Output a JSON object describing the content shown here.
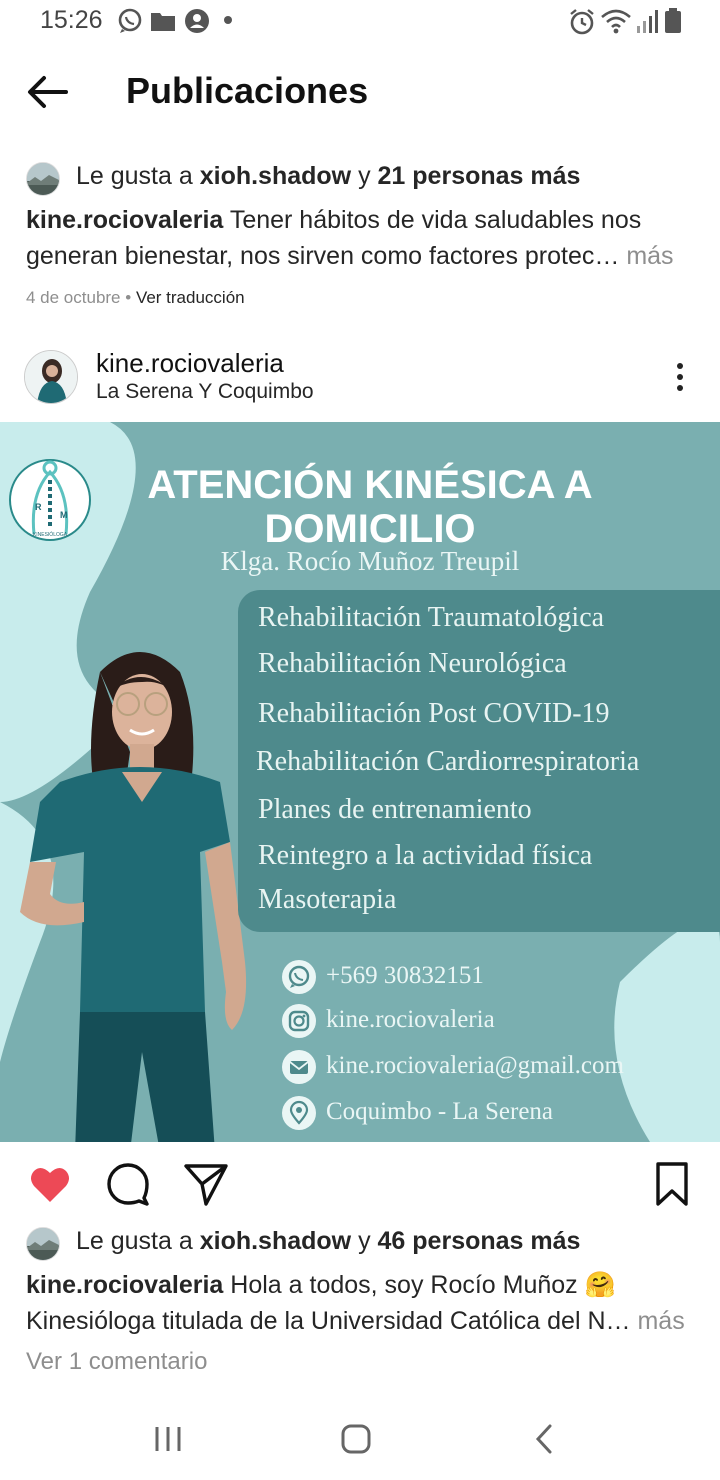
{
  "status_bar": {
    "time": "15:26",
    "left_icons": [
      "whatsapp-icon",
      "folder-icon",
      "account-icon"
    ],
    "right_icons": [
      "alarm-icon",
      "wifi-icon",
      "signal-icon",
      "battery-icon"
    ]
  },
  "header": {
    "title": "Publicaciones",
    "back_icon": "arrow-left-icon"
  },
  "previous_post": {
    "likes_prefix": "Le gusta a",
    "likes_user": "xioh.shadow",
    "likes_joiner": "y",
    "likes_count": "21 personas más",
    "caption_user": "kine.rociovaleria",
    "caption_text": "Tener hábitos de vida saludables nos generan bienestar, nos sirven como factores protec…",
    "more_label": "más",
    "date": "4 de octubre",
    "separator": "•",
    "translate_label": "Ver traducción"
  },
  "post": {
    "username": "kine.rociovaleria",
    "location": "La Serena Y Coquimbo",
    "image": {
      "logo_text": "KINESIÓLOGA",
      "logo_letters": [
        "R",
        "M"
      ],
      "title_line1": "ATENCIÓN KINÉSICA A",
      "title_line2": "DOMICILIO",
      "subtitle": "Klga. Rocío Muñoz Treupil",
      "services": [
        "Rehabilitación Traumatológica",
        "Rehabilitación Neurológica",
        "Rehabilitación Post COVID-19",
        "Rehabilitación Cardiorrespiratoria",
        "Planes de entrenamiento",
        "Reintegro a la actividad física",
        "Masoterapia"
      ],
      "contacts": [
        {
          "icon": "whatsapp-icon",
          "text": "+569 30832151"
        },
        {
          "icon": "instagram-icon",
          "text": "kine.rociovaleria"
        },
        {
          "icon": "mail-icon",
          "text": "kine.rociovaleria@gmail.com"
        },
        {
          "icon": "location-pin-icon",
          "text": "Coquimbo - La Serena"
        }
      ],
      "colors": {
        "background": "#7aafb0",
        "light_blob": "#c8ecec",
        "box": "#4e8a8c",
        "scrubs": "#1f6a74"
      }
    },
    "liked": true,
    "actions": [
      "heart-icon",
      "comment-icon",
      "share-icon",
      "bookmark-icon"
    ],
    "likes_prefix": "Le gusta a",
    "likes_user": "xioh.shadow",
    "likes_joiner": "y",
    "likes_count": "46 personas más",
    "caption_user": "kine.rociovaleria",
    "caption_line1": "Hola a todos, soy Rocío Muñoz 🤗",
    "caption_line2": "Kinesióloga titulada de la Universidad Católica del N…",
    "more_label": "más",
    "comments_link": "Ver 1 comentario"
  },
  "nav_bar": {
    "buttons": [
      "recents-icon",
      "home-icon",
      "back-icon"
    ]
  },
  "colors": {
    "heart": "#ed4956",
    "secondary_text": "#8e8e8e"
  }
}
